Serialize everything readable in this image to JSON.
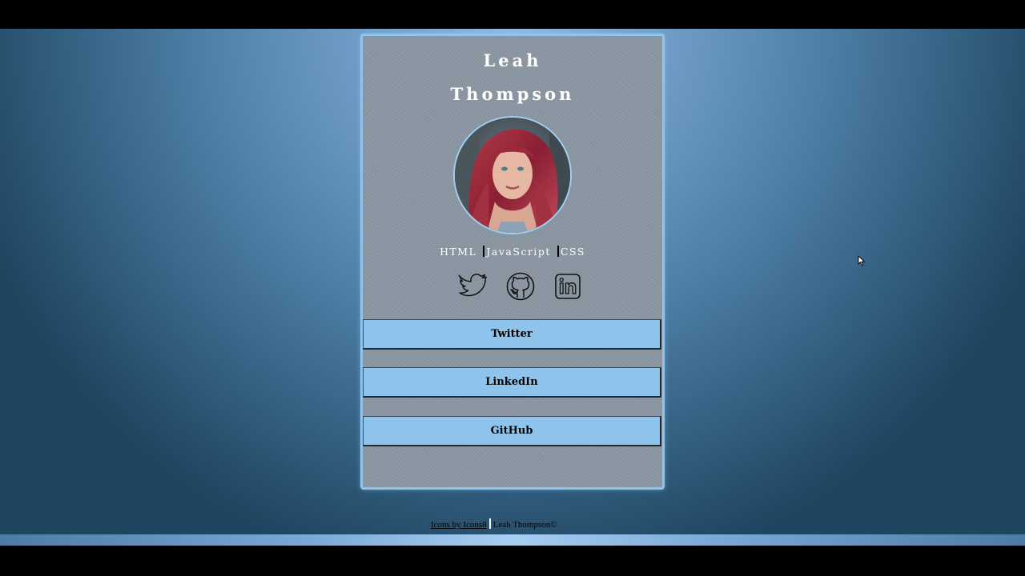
{
  "profile": {
    "first_name": "Leah",
    "last_name": "Thompson",
    "avatar_alt": "profile-photo"
  },
  "skills": [
    "HTML",
    "JavaScript",
    "CSS"
  ],
  "social_icons": [
    {
      "name": "twitter-icon"
    },
    {
      "name": "github-icon"
    },
    {
      "name": "linkedin-icon"
    }
  ],
  "buttons": {
    "twitter": "Twitter",
    "linkedin": "LinkedIn",
    "github": "GitHub"
  },
  "footer": {
    "credit_link": "Icons by Icons8",
    "copyright": "Leah Thompson©"
  },
  "colors": {
    "card_border": "#8ec4ee",
    "button_bg": "#8ec4ec",
    "card_bg": "#8a96a2"
  }
}
